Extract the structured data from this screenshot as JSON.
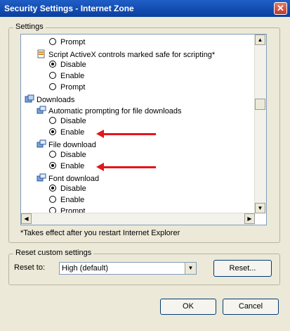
{
  "window": {
    "title": "Security Settings - Internet Zone",
    "close_glyph": "✕"
  },
  "settings": {
    "group_label": "Settings",
    "items": [
      {
        "kind": "radio",
        "label": "Prompt",
        "checked": false
      },
      {
        "kind": "setting",
        "label": "Script ActiveX controls marked safe for scripting*",
        "icon": "script-icon"
      },
      {
        "kind": "radio",
        "label": "Disable",
        "checked": true
      },
      {
        "kind": "radio",
        "label": "Enable",
        "checked": false
      },
      {
        "kind": "radio",
        "label": "Prompt",
        "checked": false
      },
      {
        "kind": "category",
        "label": "Downloads",
        "icon": "downloads-icon"
      },
      {
        "kind": "setting",
        "label": "Automatic prompting for file downloads",
        "icon": "settings-icon"
      },
      {
        "kind": "radio",
        "label": "Disable",
        "checked": false
      },
      {
        "kind": "radio",
        "label": "Enable",
        "checked": true
      },
      {
        "kind": "setting",
        "label": "File download",
        "icon": "settings-icon"
      },
      {
        "kind": "radio",
        "label": "Disable",
        "checked": false
      },
      {
        "kind": "radio",
        "label": "Enable",
        "checked": true
      },
      {
        "kind": "setting",
        "label": "Font download",
        "icon": "settings-icon"
      },
      {
        "kind": "radio",
        "label": "Disable",
        "checked": true
      },
      {
        "kind": "radio",
        "label": "Enable",
        "checked": false
      },
      {
        "kind": "radio",
        "label": "Prompt",
        "checked": false
      }
    ],
    "note": "*Takes effect after you restart Internet Explorer"
  },
  "reset": {
    "group_label": "Reset custom settings",
    "label": "Reset to:",
    "selected": "High (default)",
    "button": "Reset..."
  },
  "buttons": {
    "ok": "OK",
    "cancel": "Cancel"
  },
  "colors": {
    "arrow": "#e3161c",
    "titlebar": "#0a3f9e"
  }
}
